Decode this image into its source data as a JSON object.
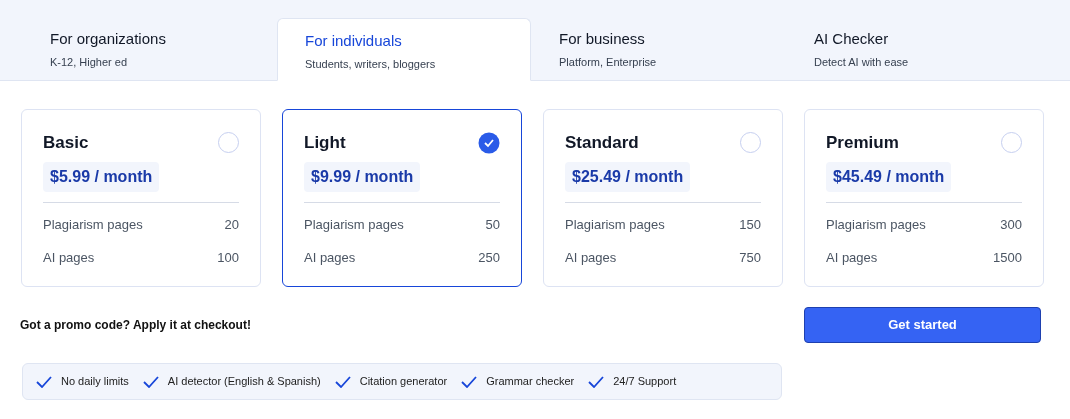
{
  "tabs": [
    {
      "label": "For organizations",
      "sublabel": "K-12, Higher ed",
      "selected": false
    },
    {
      "label": "For individuals",
      "sublabel": "Students, writers, bloggers",
      "selected": true
    },
    {
      "label": "For business",
      "sublabel": "Platform, Enterprise",
      "selected": false
    },
    {
      "label": "AI Checker",
      "sublabel": "Detect AI with ease",
      "selected": false
    }
  ],
  "plans": [
    {
      "name": "Basic",
      "price": "$5.99 / month",
      "selected": false,
      "rows": [
        {
          "label": "Plagiarism pages",
          "value": "20"
        },
        {
          "label": "AI pages",
          "value": "100"
        }
      ]
    },
    {
      "name": "Light",
      "price": "$9.99 / month",
      "selected": true,
      "rows": [
        {
          "label": "Plagiarism pages",
          "value": "50"
        },
        {
          "label": "AI pages",
          "value": "250"
        }
      ]
    },
    {
      "name": "Standard",
      "price": "$25.49 / month",
      "selected": false,
      "rows": [
        {
          "label": "Plagiarism pages",
          "value": "150"
        },
        {
          "label": "AI pages",
          "value": "750"
        }
      ]
    },
    {
      "name": "Premium",
      "price": "$45.49 / month",
      "selected": false,
      "rows": [
        {
          "label": "Plagiarism pages",
          "value": "300"
        },
        {
          "label": "AI pages",
          "value": "1500"
        }
      ]
    }
  ],
  "promo": "Got a promo code? Apply it at checkout!",
  "cta": "Get started",
  "features": [
    "No daily limits",
    "AI detector (English & Spanish)",
    "Citation generator",
    "Grammar checker",
    "24/7 Support"
  ]
}
